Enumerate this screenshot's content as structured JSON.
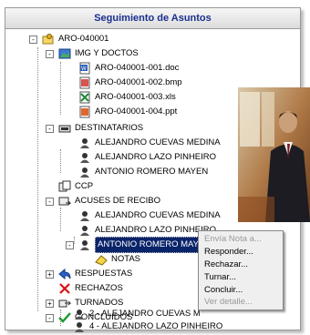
{
  "window": {
    "title": "Seguimiento de Asuntos"
  },
  "tree": [
    {
      "label": "ARO-040001",
      "icon": "folder-key-icon",
      "expander": "-"
    },
    {
      "label": "IMG Y DOCTOS",
      "icon": "images-docs-icon",
      "expander": "-"
    },
    {
      "label": "ARO-040001-001.doc",
      "icon": "word-doc-icon"
    },
    {
      "label": "ARO-040001-002.bmp",
      "icon": "bmp-file-icon"
    },
    {
      "label": "ARO-040001-003.xls",
      "icon": "excel-file-icon"
    },
    {
      "label": "ARO-040001-004.ppt",
      "icon": "powerpoint-file-icon"
    },
    {
      "label": "DESTINATARIOS",
      "icon": "recipients-icon",
      "expander": "-"
    },
    {
      "label": "ALEJANDRO CUEVAS MEDINA",
      "icon": "user-icon"
    },
    {
      "label": "ALEJANDRO LAZO PINHEIRO",
      "icon": "user-icon"
    },
    {
      "label": "ANTONIO ROMERO MAYEN",
      "icon": "user-icon"
    },
    {
      "label": "CCP",
      "icon": "copy-icon"
    },
    {
      "label": "ACUSES DE RECIBO",
      "icon": "receipts-icon",
      "expander": "-"
    },
    {
      "label": "ALEJANDRO CUEVAS MEDINA",
      "icon": "user-icon"
    },
    {
      "label": "ALEJANDRO LAZO PINHEIRO",
      "icon": "user-icon"
    },
    {
      "label": "ANTONIO ROMERO MAYEN",
      "icon": "user-icon",
      "expander": "-",
      "selected": true
    },
    {
      "label": "NOTAS",
      "icon": "notes-icon"
    },
    {
      "label": "RESPUESTAS",
      "icon": "replies-icon",
      "expander": "+"
    },
    {
      "label": "RECHAZOS",
      "icon": "rejected-x-icon"
    },
    {
      "label": "TURNADOS",
      "icon": "forwarded-icon",
      "expander": "+"
    },
    {
      "label": "CONCLUIDOS",
      "icon": "checkmark-icon",
      "expander": "-"
    },
    {
      "label": "2 - ALEJANDRO CUEVAS M",
      "icon": "user-icon"
    },
    {
      "label": "4 - ALEJANDRO LAZO PINHEIRO",
      "icon": "user-icon"
    }
  ],
  "context_menu": [
    {
      "label": "Envía Nota a...",
      "enabled": false
    },
    {
      "label": "Responder...",
      "enabled": true
    },
    {
      "label": "Rechazar...",
      "enabled": true
    },
    {
      "label": "Turnar...",
      "enabled": true
    },
    {
      "label": "Concluir...",
      "enabled": true
    },
    {
      "label": "Ver detalle...",
      "enabled": false
    }
  ],
  "colors": {
    "title_text": "#1b2f8f",
    "selection": "#0a246a"
  }
}
